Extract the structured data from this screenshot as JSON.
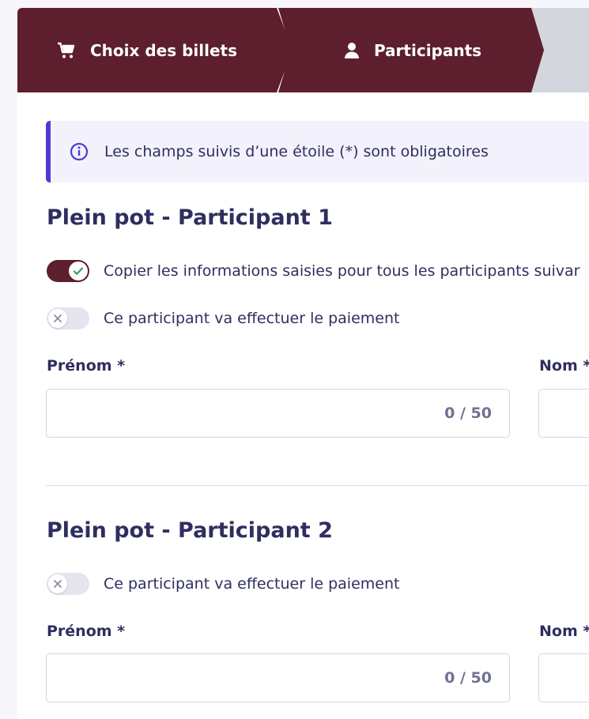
{
  "steps": [
    {
      "label": "Choix des billets",
      "icon": "cart-icon"
    },
    {
      "label": "Participants",
      "icon": "user-icon"
    },
    {
      "label": "",
      "icon": ""
    }
  ],
  "colors": {
    "primary": "#5d1f2d",
    "info_accent": "#4b3ecf",
    "text": "#2e2f5e",
    "inactive_step": "#d3d6dc"
  },
  "info_banner": {
    "text": "Les champs suivis d’une étoile (*) sont obligatoires",
    "icon": "info-icon"
  },
  "participants": [
    {
      "title": "Plein pot - Participant 1",
      "copy_toggle": {
        "label": "Copier les informations saisies pour tous les participants suivar",
        "checked": true
      },
      "payer_toggle": {
        "label": "Ce participant va effectuer le paiement",
        "checked": false
      },
      "firstname": {
        "label": "Prénom *",
        "counter": "0 / 50",
        "value": ""
      },
      "lastname": {
        "label": "Nom *"
      }
    },
    {
      "title": "Plein pot - Participant 2",
      "payer_toggle": {
        "label": "Ce participant va effectuer le paiement",
        "checked": false
      },
      "firstname": {
        "label": "Prénom *",
        "counter": "0 / 50",
        "value": ""
      },
      "lastname": {
        "label": "Nom *"
      }
    }
  ]
}
